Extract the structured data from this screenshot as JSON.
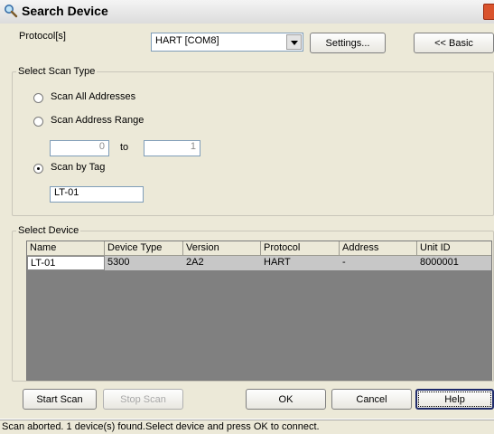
{
  "window": {
    "title": "Search Device"
  },
  "protocol": {
    "label": "Protocol[s]",
    "selected": "HART [COM8]"
  },
  "buttons": {
    "settings": "Settings...",
    "basic": "<< Basic",
    "start_scan": "Start Scan",
    "stop_scan": "Stop Scan",
    "ok": "OK",
    "cancel": "Cancel",
    "help": "Help"
  },
  "scan_type": {
    "title": "Select Scan Type",
    "all_addresses": "Scan All Addresses",
    "address_range": "Scan Address Range",
    "range_from": "0",
    "range_to_label": "to",
    "range_to": "1",
    "by_tag": "Scan by Tag",
    "tag_value": "LT-01",
    "selected": "by_tag"
  },
  "select_device": {
    "title": "Select Device",
    "columns": [
      "Name",
      "Device Type",
      "Version",
      "Protocol",
      "Address",
      "Unit ID"
    ],
    "rows": [
      [
        "LT-01",
        "5300",
        "2A2",
        "HART",
        "-",
        "8000001"
      ]
    ]
  },
  "status": {
    "text": "Scan aborted. 1 device(s) found.Select device and press OK to connect."
  },
  "icons": {
    "title": "search-icon",
    "close": "close-icon"
  }
}
